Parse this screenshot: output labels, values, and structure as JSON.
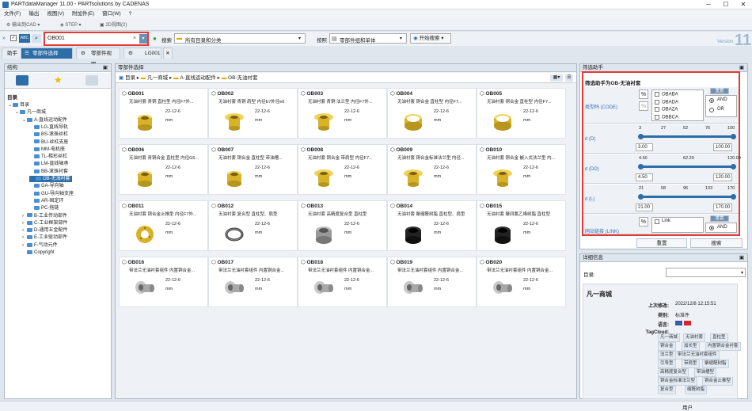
{
  "window": {
    "title": "PARTdataManager 11.00 - PARTsolutions by CADENAS"
  },
  "menu": [
    "文件(F)",
    "输出",
    "视图(V)",
    "附加件(E)",
    "窗口(W)",
    "?"
  ],
  "toolbar": {
    "export_cad": "输出到CAD",
    "step": "STEP",
    "preview2d": "2D视图(2)"
  },
  "search": {
    "value": "OB001",
    "label": "搜索",
    "scope": "所有目录和分类",
    "by_label": "按照",
    "by_value": "零部件组和单体",
    "start": "开始搜索"
  },
  "version": {
    "label": "Version",
    "num": "11"
  },
  "tabs": [
    {
      "label": "助手"
    },
    {
      "label": "零部件选择"
    },
    {
      "label": "零部件视图"
    },
    {
      "label": "LG001"
    }
  ],
  "structure": {
    "title": "结构",
    "root": "目录",
    "nodes": [
      {
        "label": "目录",
        "level": 0
      },
      {
        "label": "凡一商城",
        "level": 1
      },
      {
        "label": "A-直线运动配件",
        "level": 2
      },
      {
        "label": "LG-直线导轨",
        "level": 3
      },
      {
        "label": "BS-滚珠丝杠",
        "level": 3
      },
      {
        "label": "BU-丝杠支座",
        "level": 3
      },
      {
        "label": "MM-电机座",
        "level": 3
      },
      {
        "label": "TL-梯形丝杠",
        "level": 3
      },
      {
        "label": "LM-直线轴承",
        "level": 3
      },
      {
        "label": "BB-滚珠衬套",
        "level": 3
      },
      {
        "label": "OB-无油衬套",
        "level": 3,
        "selected": true
      },
      {
        "label": "GA-导向轴",
        "level": 3
      },
      {
        "label": "GU-导向轴支座",
        "level": 3
      },
      {
        "label": "AR-固定环",
        "level": 3
      },
      {
        "label": "PC-拖链",
        "level": 3
      },
      {
        "label": "B-工业传动部件",
        "level": 2
      },
      {
        "label": "C-工业框架部件",
        "level": 2
      },
      {
        "label": "D-通用五金配件",
        "level": 2
      },
      {
        "label": "E-工业驱动部件",
        "level": 2
      },
      {
        "label": "F-气动元件",
        "level": 2
      },
      {
        "label": "Copyright",
        "level": 2
      }
    ]
  },
  "part_select": {
    "title": "零部件选择",
    "breadcrumb": [
      "目录",
      "凡一商城",
      "A-直线运动配件",
      "OB-无油衬套"
    ],
    "cards": [
      {
        "code": "OB001",
        "desc": "无油衬套 青铜 直柱型 内径F7外...",
        "date": "22-12-6",
        "unit": "mm",
        "kind": "plain"
      },
      {
        "code": "OB002",
        "desc": "无油衬套 青铜 肩型 内径E7外径e6",
        "date": "22-12-6",
        "unit": "mm",
        "kind": "flange"
      },
      {
        "code": "OB003",
        "desc": "无油衬套 青铜 法兰型 内径F7外...",
        "date": "22-12-6",
        "unit": "mm",
        "kind": "flange"
      },
      {
        "code": "OB004",
        "desc": "无油衬套 铜合金 直柱型 内径F7...",
        "date": "22-12-6",
        "unit": "mm",
        "kind": "ring"
      },
      {
        "code": "OB005",
        "desc": "无油衬套 铜合金 直柱型 内径F7...",
        "date": "22-12-6",
        "unit": "mm",
        "kind": "ring"
      },
      {
        "code": "OB006",
        "desc": "无油衬套 青铜合金 直柱型 内径G6...",
        "date": "22-12-6",
        "unit": "mm",
        "kind": "plain"
      },
      {
        "code": "OB007",
        "desc": "无油衬套 铜合金 直柱型 带油槽...",
        "date": "22-12-6",
        "unit": "mm",
        "kind": "plain"
      },
      {
        "code": "OB008",
        "desc": "无油衬套 铜合金 带肩型 内径F7...",
        "date": "22-12-6",
        "unit": "mm",
        "kind": "flange"
      },
      {
        "code": "OB009",
        "desc": "无油衬套 铜合金标准法兰型 内径...",
        "date": "22-12-6",
        "unit": "mm",
        "kind": "flange"
      },
      {
        "code": "OB010",
        "desc": "无油衬套 铜合金 嵌入式法兰型 内...",
        "date": "22-12-6",
        "unit": "mm",
        "kind": "flange"
      },
      {
        "code": "OB011",
        "desc": "无油衬套 铜合金止推型 内径F7外...",
        "date": "22-12-6",
        "unit": "mm",
        "kind": "thrust"
      },
      {
        "code": "OB012",
        "desc": "无油衬套 复合型 直柱型、肩型",
        "date": "22-12-6",
        "unit": "mm",
        "kind": "thin"
      },
      {
        "code": "OB013",
        "desc": "无油衬套 高精度复合型 直柱型",
        "date": "22-12-6",
        "unit": "mm",
        "kind": "grey"
      },
      {
        "code": "OB014",
        "desc": "无油衬套 聚缩醛树脂 直柱型、肩型",
        "date": "22-12-6",
        "unit": "mm",
        "kind": "black"
      },
      {
        "code": "OB015",
        "desc": "无油衬套 聚四氟乙烯树脂 直柱型",
        "date": "22-12-6",
        "unit": "mm",
        "kind": "black"
      },
      {
        "code": "OB016",
        "desc": "带法兰无油衬套组件 内置铜合金...",
        "date": "22-12-6",
        "unit": "mm",
        "kind": "assy"
      },
      {
        "code": "OB017",
        "desc": "带法兰无油衬套组件 内置铜合金...",
        "date": "22-12-6",
        "unit": "mm",
        "kind": "assy"
      },
      {
        "code": "OB018",
        "desc": "带法兰无油衬套组件 内置铜合金...",
        "date": "22-12-6",
        "unit": "mm",
        "kind": "assy"
      },
      {
        "code": "OB019",
        "desc": "带法兰无油衬套组件 内置铜合金...",
        "date": "22-12-6",
        "unit": "mm",
        "kind": "assy"
      },
      {
        "code": "OB020",
        "desc": "带法兰无油衬套组件 内置铜合金...",
        "date": "22-12-6",
        "unit": "mm",
        "kind": "assy"
      }
    ]
  },
  "filter": {
    "panel_title": "筛选助手",
    "title": "筛选助手为OB-无油衬套",
    "code_label": "类型码 (CODE)",
    "codes": [
      "OBABA",
      "OBADA",
      "OBAZA",
      "OBBCA"
    ],
    "reset": "重置",
    "and": "AND",
    "or": "OR",
    "d": {
      "label": "d (D)",
      "ticks": [
        "3",
        "27",
        "52",
        "76",
        "100"
      ],
      "min": "3.00",
      "max": "100.00"
    },
    "dd": {
      "label": "d (DD)",
      "ticks": [
        "4.50",
        "62.20",
        "120.00"
      ],
      "min": "4.50",
      "max": "120.00"
    },
    "l": {
      "label": "d (L)",
      "ticks": [
        "21",
        "58",
        "96",
        "133",
        "170"
      ],
      "min": "21.00",
      "max": "170.00"
    },
    "link_label": "网站链接 (LINK)",
    "link_item": "Link",
    "link_and": "AND",
    "reset_btn": "重置",
    "search_btn": "搜索"
  },
  "details": {
    "title": "详细信息",
    "sel_label": "目录:",
    "name": "凡一商城",
    "upd_label": "上次修改:",
    "upd_value": "2022/12/8 12:15:51",
    "type_label": "类别:",
    "type_value": "标准件",
    "lang_label": "语言:",
    "tag_label": "TagCloud:",
    "tags": [
      "凡一商城",
      "无油衬套",
      "直柱型",
      "铜合金",
      "加长型",
      "内置铜合金衬套",
      "法兰型",
      "带法兰无油衬套组件",
      "引导型",
      "带肩型",
      "聚缩醛树脂",
      "高精度复合型",
      "带油槽型",
      "铜合金标准法兰型",
      "铜合金止推型",
      "复合型",
      "缩醛树脂"
    ]
  },
  "statusbar": {
    "user": "用户"
  },
  "colors": {
    "accent": "#2d6ea8",
    "highlight": "#e53935",
    "brass": "#d7b22a"
  }
}
